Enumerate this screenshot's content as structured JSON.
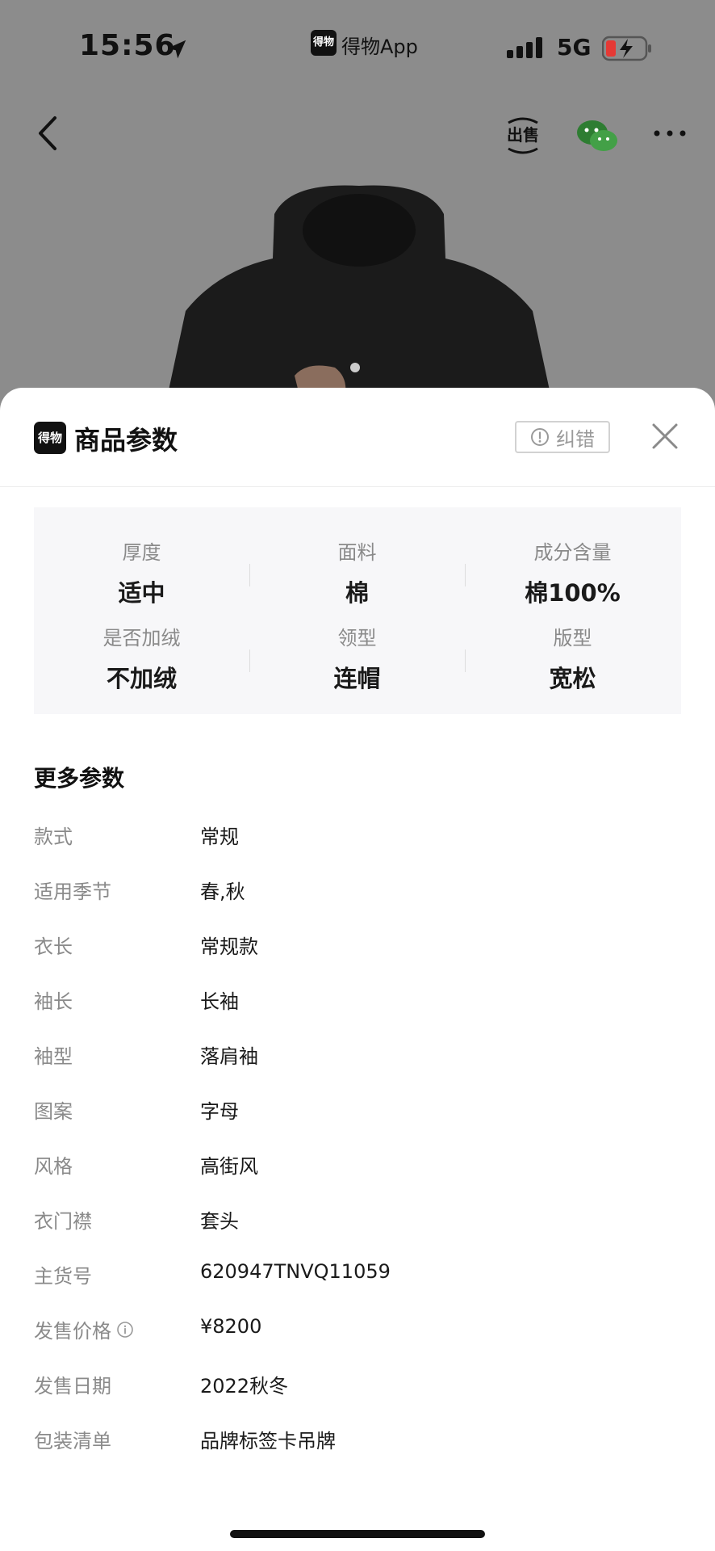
{
  "status_bar": {
    "time": "15:56",
    "app_badge": "得物",
    "app_name": "得物App",
    "network": "5G"
  },
  "nav": {
    "sell_label": "出售"
  },
  "sheet": {
    "logo_text": "得物",
    "title": "商品参数",
    "report_label": "纠错",
    "params": [
      {
        "label": "厚度",
        "value": "适中"
      },
      {
        "label": "面料",
        "value": "棉"
      },
      {
        "label": "成分含量",
        "value": "棉100%"
      },
      {
        "label": "是否加绒",
        "value": "不加绒"
      },
      {
        "label": "领型",
        "value": "连帽"
      },
      {
        "label": "版型",
        "value": "宽松"
      }
    ],
    "more_title": "更多参数",
    "rows": [
      {
        "key": "款式",
        "value": "常规"
      },
      {
        "key": "适用季节",
        "value": "春,秋"
      },
      {
        "key": "衣长",
        "value": "常规款"
      },
      {
        "key": "袖长",
        "value": "长袖"
      },
      {
        "key": "袖型",
        "value": "落肩袖"
      },
      {
        "key": "图案",
        "value": "字母"
      },
      {
        "key": "风格",
        "value": "高街风"
      },
      {
        "key": "衣门襟",
        "value": "套头"
      },
      {
        "key": "主货号",
        "value": "620947TNVQ11059"
      },
      {
        "key": "发售价格",
        "value": "¥8200"
      },
      {
        "key": "发售日期",
        "value": "2022秋冬"
      },
      {
        "key": "包装清单",
        "value": "品牌标签卡吊牌"
      }
    ]
  }
}
